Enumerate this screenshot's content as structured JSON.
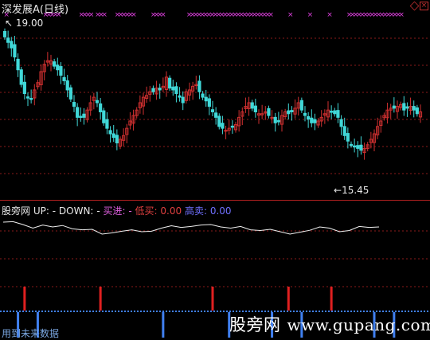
{
  "header": {
    "title": "深发展A",
    "period": "(日线)"
  },
  "price_panel": {
    "high_label": "19.00",
    "low_label": "15.45",
    "high_arrow": "↖",
    "low_arrow": "←",
    "ylim": [
      15.0,
      19.4
    ]
  },
  "indicator": {
    "name": "股旁网",
    "up_label": "UP:",
    "up_value": "-",
    "down_label": "DOWN:",
    "down_value": "-",
    "buy_label": "买进:",
    "buy_value": "-",
    "low_buy_label": "低买:",
    "low_buy_value": "0.00",
    "high_sell_label": "高卖:",
    "high_sell_value": "0.00"
  },
  "watermark": {
    "cn": "股旁网",
    "url": "www.gupang.com"
  },
  "footer": {
    "text": "用到未来数据"
  },
  "colors": {
    "up_candle": "#d03030",
    "down_candle": "#40d8d8",
    "marker_x": "#e040e0",
    "signal_red": "#e02020",
    "signal_blue": "#4080f0",
    "grid": "#8b1a1a",
    "curve": "#f0f0f0",
    "label_red": "#e04040",
    "label_blue": "#7070ff",
    "label_magenta": "#e060e0"
  },
  "chart_data": {
    "type": "candlestick",
    "ylim": [
      15.0,
      19.4
    ],
    "close": [
      19.0,
      18.85,
      18.7,
      18.45,
      18.1,
      17.7,
      17.45,
      17.35,
      17.3,
      17.55,
      17.75,
      18.05,
      18.25,
      18.35,
      18.35,
      18.2,
      18.1,
      17.95,
      17.8,
      17.55,
      17.3,
      17.1,
      16.8,
      16.8,
      16.8,
      17.0,
      17.2,
      17.35,
      17.2,
      16.95,
      16.65,
      16.5,
      16.35,
      16.25,
      16.1,
      16.2,
      16.3,
      16.5,
      16.7,
      16.85,
      17.0,
      17.2,
      17.35,
      17.4,
      17.5,
      17.5,
      17.6,
      17.55,
      17.65,
      17.9,
      17.6,
      17.55,
      17.45,
      17.35,
      17.2,
      17.5,
      17.55,
      17.65,
      17.7,
      17.5,
      17.35,
      17.25,
      17.1,
      16.95,
      16.8,
      16.55,
      16.5,
      16.45,
      16.5,
      16.55,
      16.6,
      16.8,
      16.95,
      17.1,
      17.2,
      17.05,
      16.95,
      16.9,
      16.9,
      16.95,
      16.85,
      16.8,
      16.65,
      16.7,
      16.85,
      16.95,
      16.9,
      16.95,
      17.05,
      17.2,
      17.0,
      16.85,
      16.75,
      16.65,
      16.65,
      16.7,
      16.8,
      16.9,
      17.0,
      16.95,
      16.9,
      16.8,
      16.55,
      16.3,
      16.15,
      16.05,
      16.0,
      15.95,
      15.9,
      15.95,
      16.05,
      16.2,
      16.35,
      16.55,
      16.7,
      16.85,
      17.0,
      17.05,
      17.05,
      17.1,
      17.15,
      17.0,
      17.05,
      17.1,
      17.0,
      16.9,
      16.95
    ],
    "marker_x_indices": [
      1,
      13,
      14,
      15,
      16,
      17,
      24,
      25,
      26,
      27,
      29,
      30,
      31,
      35,
      36,
      37,
      38,
      39,
      40,
      46,
      47,
      48,
      49,
      57,
      58,
      59,
      60,
      61,
      62,
      63,
      64,
      65,
      66,
      67,
      68,
      69,
      70,
      71,
      72,
      73,
      74,
      75,
      76,
      77,
      78,
      79,
      80,
      81,
      82,
      88,
      94,
      100,
      106,
      107,
      108,
      109,
      110,
      111,
      112,
      113,
      114,
      115,
      116,
      117,
      118,
      119,
      120,
      121,
      122
    ],
    "indicator_curve": [
      0.7,
      0.72,
      0.6,
      0.45,
      0.58,
      0.5,
      0.56,
      0.42,
      0.38,
      0.4,
      0.2,
      0.25,
      0.32,
      0.38,
      0.3,
      0.32,
      0.45,
      0.55,
      0.48,
      0.52,
      0.58,
      0.6,
      0.5,
      0.45,
      0.52,
      0.38,
      0.35,
      0.4,
      0.3,
      0.2,
      0.28,
      0.36,
      0.5,
      0.45,
      0.3,
      0.35,
      0.52,
      0.48,
      0.5
    ],
    "red_signal_indices": [
      6,
      29,
      63,
      86,
      99
    ],
    "blue_signal_indices": [
      4,
      10,
      48,
      68,
      81,
      90,
      112,
      118
    ]
  }
}
